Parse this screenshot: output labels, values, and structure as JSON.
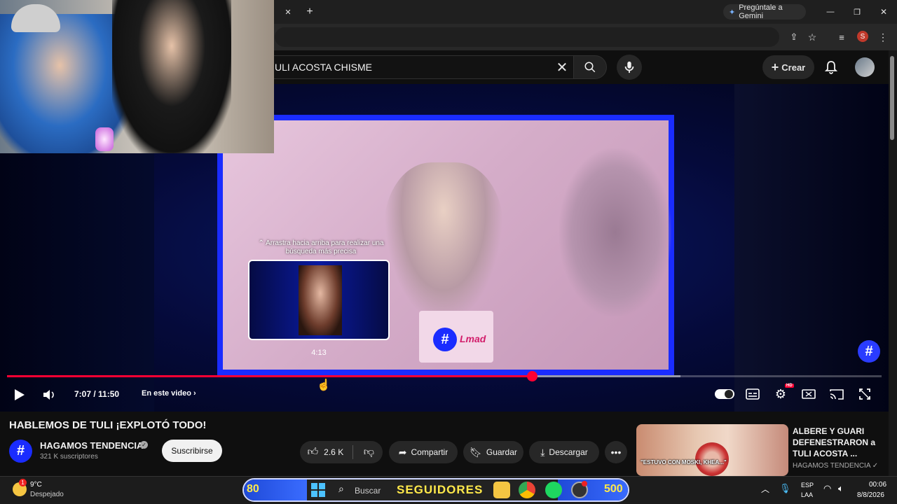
{
  "browser": {
    "gemini_label": "Pregúntale a Gemini",
    "profile_initial": "S",
    "new_tab": "+",
    "close_tab": "✕",
    "window_min": "—",
    "window_max": "❐",
    "window_close": "✕"
  },
  "youtube": {
    "search_query": "ULI ACOSTA CHISME",
    "create_label": "Crear"
  },
  "player": {
    "drag_hint": "⌃ Arrastra hacia arriba para realizar una búsqueda más precisa",
    "preview_time": "4:13",
    "current_time": "7:07 / 11:50",
    "chapters_label": "En este video",
    "progress_played": 0.6,
    "progress_loaded": 0.77,
    "preview_brand": "Lmad",
    "hd_badge": "HD"
  },
  "video": {
    "title": "HABLEMOS DE TULI ¡EXPLOTÓ TODO!",
    "channel": "HAGAMOS TENDENCIA",
    "subscribers": "321 K suscriptores",
    "subscribe_label": "Suscribirse",
    "likes": "2.6 K",
    "share_label": "Compartir",
    "save_label": "Guardar",
    "download_label": "Descargar"
  },
  "recommendation": {
    "title": "ALBERE Y GUARI DEFENESTRARON a TULI ACOSTA ...",
    "channel": "HAGAMOS TENDENCIA",
    "thumb_caption": "\"ESTUVO CON MOSKI, KHEA...\""
  },
  "taskbar": {
    "temperature": "9°C",
    "weather": "Despejado",
    "weather_badge": "1",
    "search_placeholder": "Buscar",
    "overlay_left": "80",
    "overlay_center": "SEGUIDORES",
    "overlay_right": "500",
    "lang_1": "ESP",
    "lang_2": "LAA",
    "time": "00:06",
    "date": "8/8/2026"
  },
  "colors": {
    "accent": "#ff0033",
    "frame_blue": "#1a2cff"
  }
}
